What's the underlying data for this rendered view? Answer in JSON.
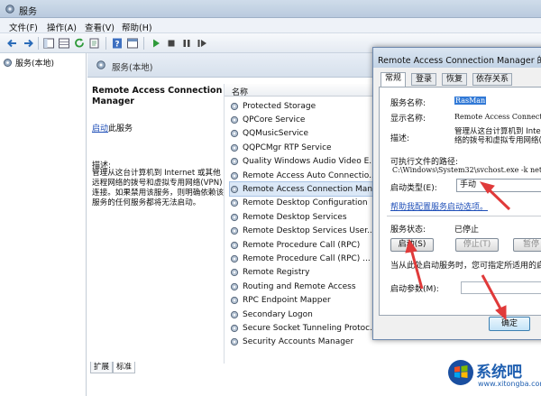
{
  "window": {
    "title": "服务"
  },
  "menu": [
    "文件(F)",
    "操作(A)",
    "查看(V)",
    "帮助(H)"
  ],
  "tree": {
    "root_label": "服务(本地)"
  },
  "header": {
    "title": "服务(本地)"
  },
  "detail": {
    "service_name": "Remote Access Connection Manager",
    "start_link": "启动",
    "start_suffix": "此服务",
    "description_label": "描述:",
    "description_text": "管理从这台计算机到 Internet 或其他远程网络的拨号和虚拟专用网络(VPN)连接。如果禁用该服务，则明确依赖该服务的任何服务都将无法启动。"
  },
  "list": {
    "column_name": "名称",
    "rows": [
      "Protected Storage",
      "QPCore Service",
      "QQMusicService",
      "QQPCMgr RTP Service",
      "Quality Windows Audio Video E...",
      "Remote Access Auto Connectio...",
      "Remote Access Connection Man...",
      "Remote Desktop Configuration",
      "Remote Desktop Services",
      "Remote Desktop Services User...",
      "Remote Procedure Call (RPC)",
      "Remote Procedure Call (RPC) ...",
      "Remote Registry",
      "Routing and Remote Access",
      "RPC Endpoint Mapper",
      "Secondary Logon",
      "Secure Socket Tunneling Protoc...",
      "Security Accounts Manager"
    ],
    "selected_index": 6
  },
  "bottom_tabs": [
    "扩展",
    "标准"
  ],
  "dialog": {
    "title": "Remote Access Connection Manager 的属性",
    "tabs": [
      "常规",
      "登录",
      "恢复",
      "依存关系"
    ],
    "service_name_label": "服务名称:",
    "service_name_value": "RasMan",
    "display_name_label": "显示名称:",
    "display_name_value": "Remote Access Connection",
    "desc_label": "描述:",
    "desc_value": "管理从这台计算机到 Inte 络的拨号和虚拟专用网络(",
    "path_label": "可执行文件的路径:",
    "path_value": "C:\\Windows\\System32\\svchost.exe -k net",
    "startup_type_label": "启动类型(E):",
    "startup_type_value": "手动",
    "help_link": "帮助我配置服务启动选项。",
    "status_label": "服务状态:",
    "status_value": "已停止",
    "start_button": "启动(S)",
    "stop_button": "停止(T)",
    "pause_button": "暂停",
    "note": "当从此处启动服务时，您可指定所适用的启动参数",
    "params_label": "启动参数(M):",
    "ok_button": "确定"
  },
  "watermark": {
    "name": "系统吧",
    "url": "www.xitongba.com"
  }
}
